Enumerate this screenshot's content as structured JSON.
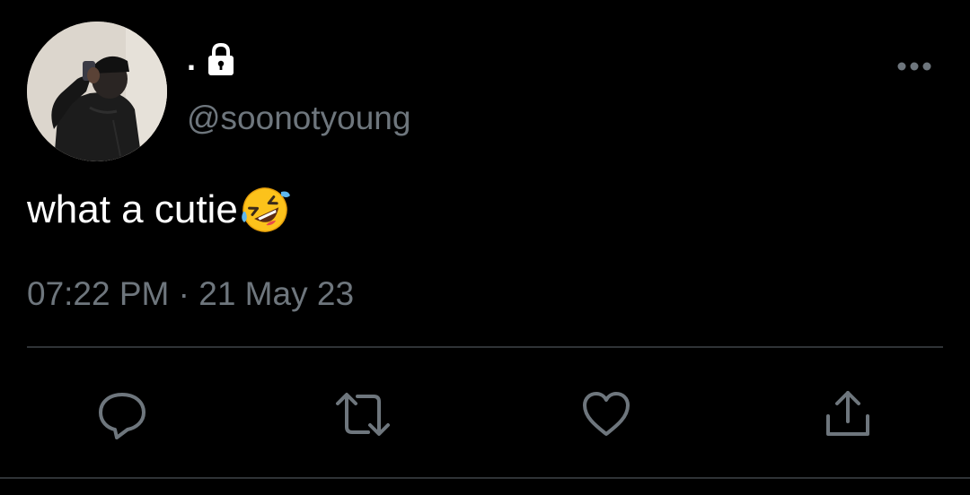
{
  "user": {
    "display_name": ".",
    "handle": "@soonotyoung",
    "avatar_icon": "avatar-photo",
    "protected_icon": "lock-icon"
  },
  "tweet": {
    "text": "what a cutie",
    "emoji_icon": "rolling-on-floor-laughing-emoji",
    "timestamp": "07:22 PM · 21 May 23"
  },
  "actions": [
    {
      "name": "reply",
      "icon": "reply-icon"
    },
    {
      "name": "retweet",
      "icon": "retweet-icon"
    },
    {
      "name": "like",
      "icon": "heart-icon"
    },
    {
      "name": "share",
      "icon": "share-icon"
    }
  ],
  "colors": {
    "background": "#000000",
    "primary_text": "#ffffff",
    "secondary_text": "#6e767d",
    "divider": "#2f3336"
  }
}
